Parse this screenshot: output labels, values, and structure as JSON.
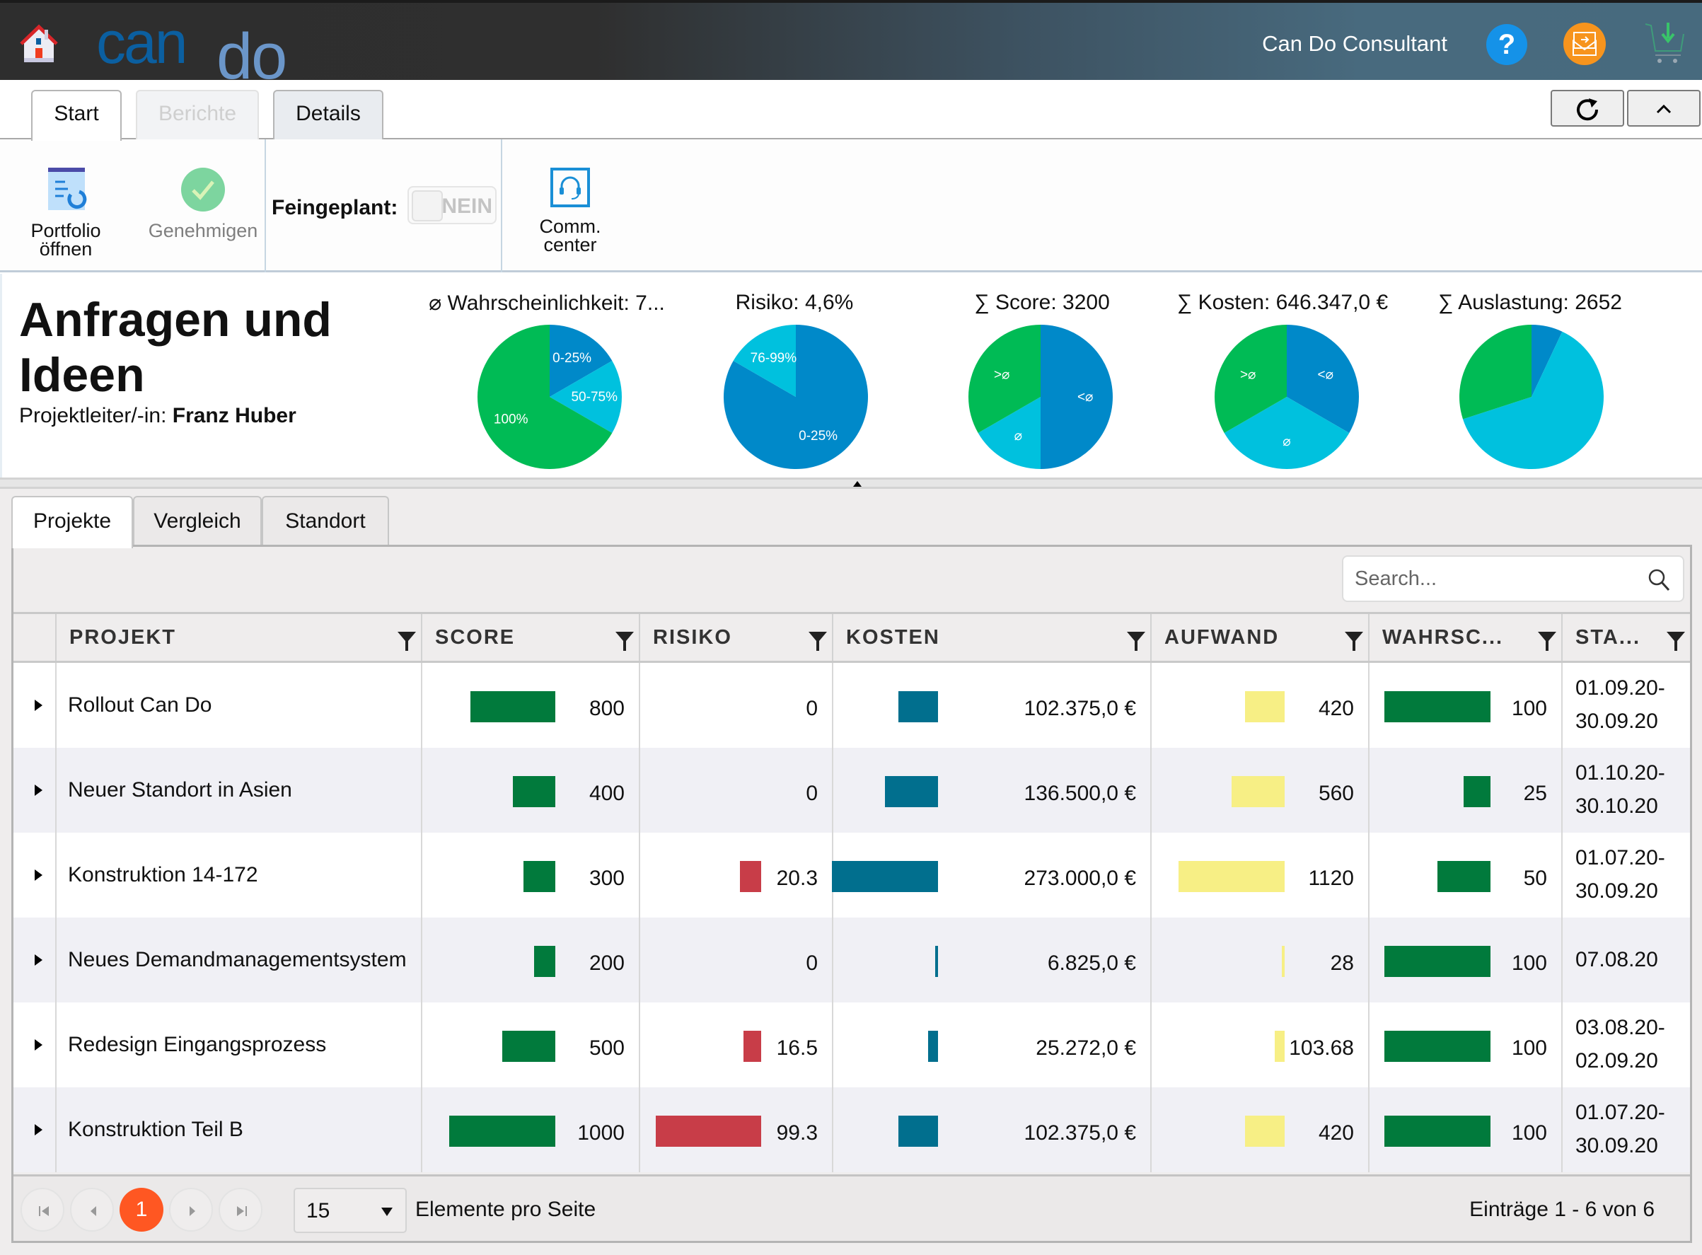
{
  "header": {
    "logo_part1": "can",
    "logo_part2": "do",
    "user_name": "Can Do Consultant",
    "icons": [
      "home-icon",
      "help-icon",
      "inbox-icon",
      "cart-download-icon"
    ],
    "help_glyph": "?"
  },
  "ribbon": {
    "tabs": [
      {
        "label": "Start",
        "state": "active"
      },
      {
        "label": "Berichte",
        "state": "disabled"
      },
      {
        "label": "Details",
        "state": "normal"
      }
    ],
    "refresh_icon": "refresh-icon",
    "collapse_icon": "chevron-up-icon"
  },
  "toolbar": {
    "portfolio_label_1": "Portfolio",
    "portfolio_label_2": "öffnen",
    "approve_label": "Genehmigen",
    "feingeplant_label": "Feingeplant:",
    "feingeplant_value": "NEIN",
    "comm_label_1": "Comm.",
    "comm_label_2": "center"
  },
  "summary": {
    "title_line1": "Anfragen und",
    "title_line2": "Ideen",
    "pm_label": "Projektleiter/-in:",
    "pm_name": "Franz Huber"
  },
  "colors": {
    "pie_blue": "#0089c9",
    "pie_cyan": "#00c1de",
    "pie_green": "#00bb55",
    "score_bar": "#017a3c",
    "risk_bar": "#c83d48",
    "cost_bar": "#016f8e",
    "effort_bar": "#f7ef85",
    "prob_bar": "#017a3c",
    "page_current": "#ff5722"
  },
  "chart_data": [
    {
      "type": "pie",
      "title": "⌀ Wahrscheinlichkeit: 7...",
      "slices": [
        {
          "label": "0-25%",
          "value": 1,
          "color": "#0089c9"
        },
        {
          "label": "50-75%",
          "value": 1,
          "color": "#00c1de"
        },
        {
          "label": "100%",
          "value": 4,
          "color": "#00bb55"
        }
      ]
    },
    {
      "type": "pie",
      "title": "Risiko: 4,6%",
      "slices": [
        {
          "label": "0-25%",
          "value": 5,
          "color": "#0089c9"
        },
        {
          "label": "76-99%",
          "value": 1,
          "color": "#00c1de"
        }
      ]
    },
    {
      "type": "pie",
      "title": "∑ Score: 3200",
      "slices": [
        {
          "label": "<⌀",
          "value": 3,
          "color": "#0089c9"
        },
        {
          "label": "⌀",
          "value": 1,
          "color": "#00c1de"
        },
        {
          "label": ">⌀",
          "value": 2,
          "color": "#00bb55"
        }
      ]
    },
    {
      "type": "pie",
      "title": "∑ Kosten: 646.347,0 €",
      "slices": [
        {
          "label": "<⌀",
          "value": 2,
          "color": "#0089c9"
        },
        {
          "label": "⌀",
          "value": 2,
          "color": "#00c1de"
        },
        {
          "label": ">⌀",
          "value": 2,
          "color": "#00bb55"
        }
      ]
    },
    {
      "type": "pie",
      "title": "∑ Auslastung: 2652",
      "slices": [
        {
          "label": "",
          "value": 7,
          "color": "#0089c9"
        },
        {
          "label": "",
          "value": 63,
          "color": "#00c1de"
        },
        {
          "label": "",
          "value": 30,
          "color": "#00bb55"
        }
      ]
    }
  ],
  "lower_tabs": [
    {
      "label": "Projekte",
      "active": true
    },
    {
      "label": "Vergleich",
      "active": false
    },
    {
      "label": "Standort",
      "active": false
    }
  ],
  "grid": {
    "search_placeholder": "Search...",
    "columns": [
      "PROJEKT",
      "SCORE",
      "RISIKO",
      "KOSTEN",
      "AUFWAND",
      "WAHRSC...",
      "STA..."
    ],
    "max": {
      "score": 1000,
      "risk": 100,
      "cost": 273000,
      "effort": 1120,
      "prob": 100
    },
    "rows": [
      {
        "name": "Rollout Can Do",
        "score": 800,
        "score_text": "800",
        "risk": 0,
        "risk_text": "0",
        "cost": 102375,
        "cost_text": "102.375,0 €",
        "effort": 420,
        "effort_text": "420",
        "prob": 100,
        "prob_text": "100",
        "date1": "01.09.20-",
        "date2": "30.09.20"
      },
      {
        "name": "Neuer Standort in Asien",
        "score": 400,
        "score_text": "400",
        "risk": 0,
        "risk_text": "0",
        "cost": 136500,
        "cost_text": "136.500,0 €",
        "effort": 560,
        "effort_text": "560",
        "prob": 25,
        "prob_text": "25",
        "date1": "01.10.20-",
        "date2": "30.10.20"
      },
      {
        "name": "Konstruktion 14-172",
        "score": 300,
        "score_text": "300",
        "risk": 20.3,
        "risk_text": "20.3",
        "cost": 273000,
        "cost_text": "273.000,0 €",
        "effort": 1120,
        "effort_text": "1120",
        "prob": 50,
        "prob_text": "50",
        "date1": "01.07.20-",
        "date2": "30.09.20"
      },
      {
        "name": "Neues Demandmanagementsystem",
        "score": 200,
        "score_text": "200",
        "risk": 0,
        "risk_text": "0",
        "cost": 6825,
        "cost_text": "6.825,0 €",
        "effort": 28,
        "effort_text": "28",
        "prob": 100,
        "prob_text": "100",
        "date1": "07.08.20",
        "date2": ""
      },
      {
        "name": "Redesign Eingangsprozess",
        "score": 500,
        "score_text": "500",
        "risk": 16.5,
        "risk_text": "16.5",
        "cost": 25272,
        "cost_text": "25.272,0 €",
        "effort": 103.68,
        "effort_text": "103.68",
        "prob": 100,
        "prob_text": "100",
        "date1": "03.08.20-",
        "date2": "02.09.20"
      },
      {
        "name": "Konstruktion Teil B",
        "score": 1000,
        "score_text": "1000",
        "risk": 99.3,
        "risk_text": "99.3",
        "cost": 102375,
        "cost_text": "102.375,0 €",
        "effort": 420,
        "effort_text": "420",
        "prob": 100,
        "prob_text": "100",
        "date1": "01.07.20-",
        "date2": "30.09.20"
      }
    ]
  },
  "pager": {
    "current_page": "1",
    "page_size": "15",
    "per_page_label": "Elemente pro Seite",
    "entries_label": "Einträge 1 - 6 von 6"
  }
}
